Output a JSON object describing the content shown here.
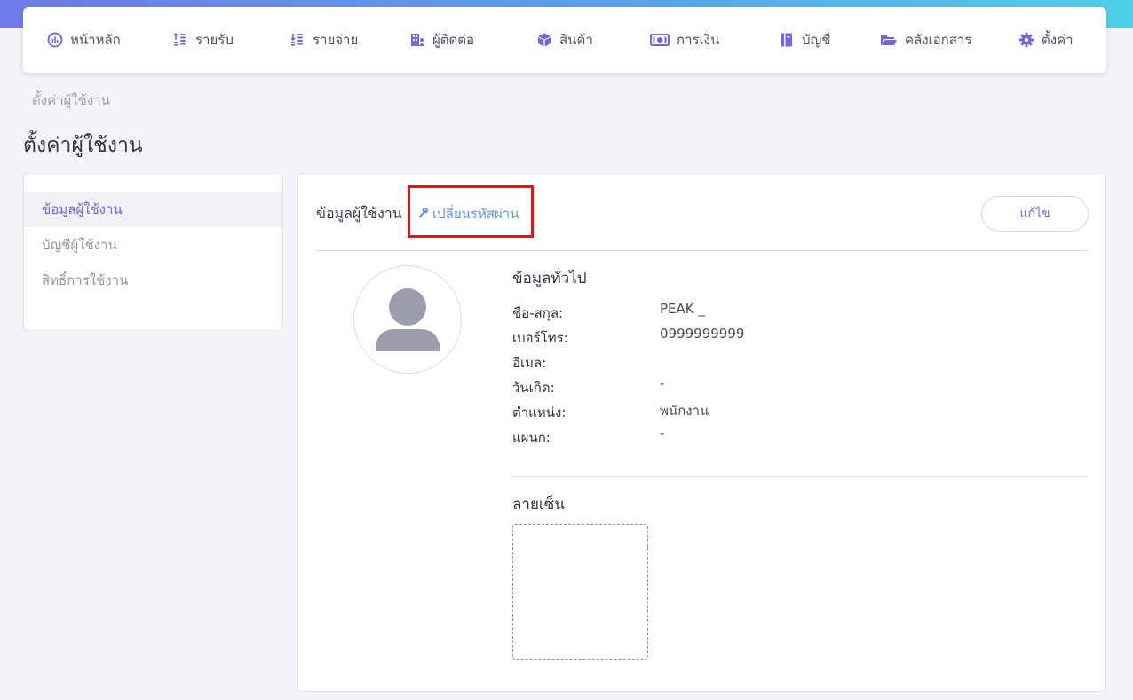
{
  "nav": {
    "items": [
      {
        "label": "หน้าหลัก",
        "icon": "dashboard-gauge-icon"
      },
      {
        "label": "รายรับ",
        "icon": "income-coins-icon"
      },
      {
        "label": "รายจ่าย",
        "icon": "expense-coins-icon"
      },
      {
        "label": "ผู้ติดต่อ",
        "icon": "contacts-building-icon"
      },
      {
        "label": "สินค้า",
        "icon": "product-box-icon"
      },
      {
        "label": "การเงิน",
        "icon": "money-bill-icon"
      },
      {
        "label": "บัญชี",
        "icon": "ledger-book-icon"
      },
      {
        "label": "คลังเอกสาร",
        "icon": "folder-open-icon"
      },
      {
        "label": "ตั้งค่า",
        "icon": "gear-icon"
      }
    ]
  },
  "breadcrumb": "ตั้งค่าผู้ใช้งาน",
  "page_title": "ตั้งค่าผู้ใช้งาน",
  "sidebar": {
    "items": [
      {
        "label": "ข้อมูลผู้ใช้งาน",
        "active": true
      },
      {
        "label": "บัญชีผู้ใช้งาน",
        "active": false
      },
      {
        "label": "สิทธิ์การใช้งาน",
        "active": false
      }
    ]
  },
  "main": {
    "section_title": "ข้อมูลผู้ใช้งาน",
    "change_password_label": "เปลี่ยนรหัสผ่าน",
    "edit_button_label": "แก้ไข",
    "info_heading": "ข้อมูลทั่วไป",
    "fields": [
      {
        "label": "ชื่อ-สกุล:",
        "value": "PEAK _"
      },
      {
        "label": "เบอร์โทร:",
        "value": "0999999999"
      },
      {
        "label": "อีเมล:",
        "value": ""
      },
      {
        "label": "วันเกิด:",
        "value": "-"
      },
      {
        "label": "ตำแหน่ง:",
        "value": "พนักงาน"
      },
      {
        "label": "แผนก:",
        "value": "-"
      }
    ],
    "signature_heading": "ลายเซ็น"
  },
  "colors": {
    "accent": "#6d67e4",
    "link": "#5a8fe0",
    "highlight": "#e8101a",
    "gradient_start": "#6f7ae8",
    "gradient_end": "#4bd0e6"
  }
}
